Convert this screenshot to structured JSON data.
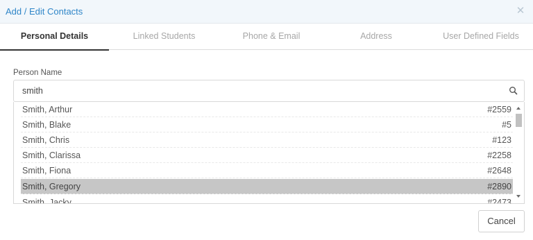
{
  "dialog": {
    "title": "Add / Edit Contacts",
    "close_icon": "close-icon"
  },
  "tabs": [
    {
      "label": "Personal Details",
      "active": true
    },
    {
      "label": "Linked Students",
      "active": false
    },
    {
      "label": "Phone & Email",
      "active": false
    },
    {
      "label": "Address",
      "active": false
    },
    {
      "label": "User Defined Fields",
      "active": false
    }
  ],
  "person_field": {
    "label": "Person Name",
    "value": "smith",
    "search_icon": "search-icon"
  },
  "results": [
    {
      "name": "Smith, Arthur",
      "id": "#2559",
      "selected": false
    },
    {
      "name": "Smith, Blake",
      "id": "#5",
      "selected": false
    },
    {
      "name": "Smith, Chris",
      "id": "#123",
      "selected": false
    },
    {
      "name": "Smith, Clarissa",
      "id": "#2258",
      "selected": false
    },
    {
      "name": "Smith, Fiona",
      "id": "#2648",
      "selected": false
    },
    {
      "name": "Smith, Gregory",
      "id": "#2890",
      "selected": true
    },
    {
      "name": "Smith, Jacky",
      "id": "#2473",
      "selected": false
    }
  ],
  "footer": {
    "cancel_label": "Cancel"
  },
  "colors": {
    "accent": "#2f86c8",
    "selected_row": "#c6c6c6",
    "titlebar_bg": "#f2f7fb"
  }
}
